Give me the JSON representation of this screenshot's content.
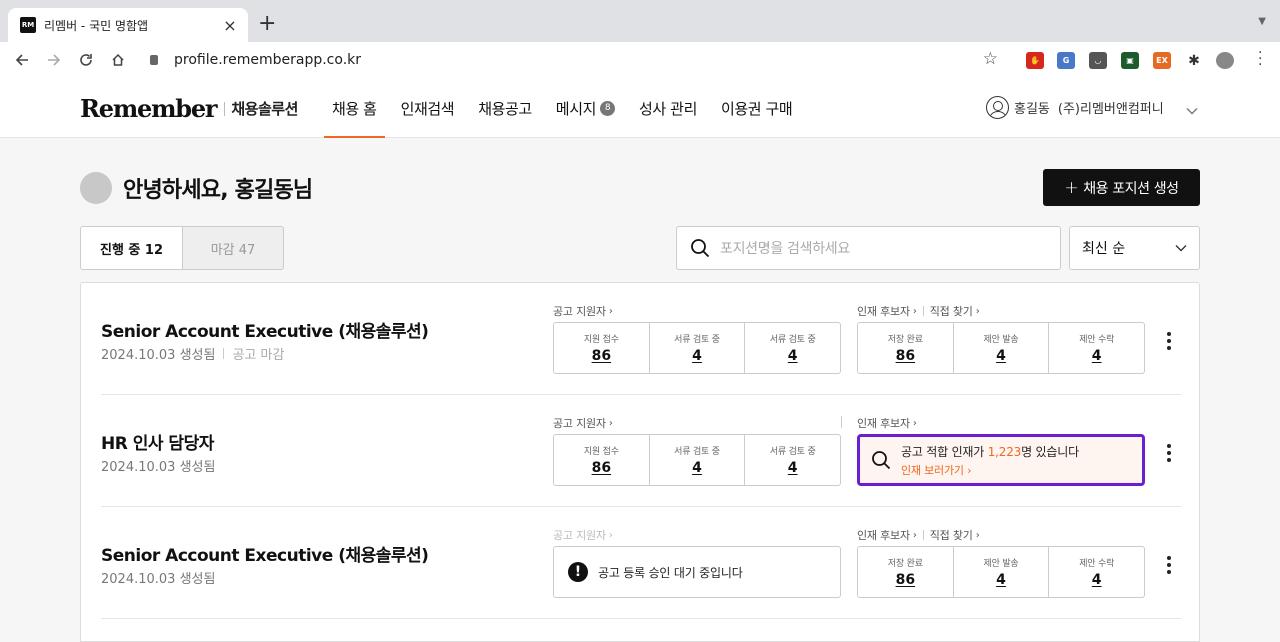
{
  "browser": {
    "tab_title": "리멤버 - 국민 명함앱",
    "favicon_text": "RM",
    "url": "profile.rememberapp.co.kr"
  },
  "header": {
    "logo": "Remember",
    "logo_sub": "채용솔루션",
    "nav": [
      {
        "label": "채용 홈",
        "active": true
      },
      {
        "label": "인재검색"
      },
      {
        "label": "채용공고"
      },
      {
        "label": "메시지",
        "badge": "8"
      },
      {
        "label": "성사 관리"
      },
      {
        "label": "이용권 구매"
      }
    ],
    "user_name": "홍길동",
    "company": "(주)리멤버앤컴퍼니"
  },
  "main": {
    "greeting": "안녕하세요, 홍길동님",
    "create_button": "채용 포지션 생성",
    "tabs": [
      "진행 중 12",
      "마감 47"
    ],
    "search_placeholder": "포지션명을 검색하세요",
    "sort": "최신 순"
  },
  "labels": {
    "applicants": "공고 지원자",
    "candidates": "인재 후보자",
    "direct": "직접 찾기",
    "stat_received": "지원 접수",
    "stat_reviewing": "서류 검토 중",
    "stat_saved": "저장 완료",
    "stat_sent": "제안 발송",
    "stat_accepted": "제안 수락"
  },
  "jobs": [
    {
      "title": "Senior Account Executive (채용솔루션)",
      "date": "2024.10.03 생성됨",
      "status": "공고 마감",
      "applicants": [
        "86",
        "4",
        "4"
      ],
      "candidates": [
        "86",
        "4",
        "4"
      ]
    },
    {
      "title": "HR 인사 담당자",
      "date": "2024.10.03 생성됨",
      "applicants": [
        "86",
        "4",
        "4"
      ],
      "promo_prefix": "공고 적합 인재가 ",
      "promo_count": "1,223",
      "promo_suffix": "명 있습니다",
      "promo_link": "인재 보러가기"
    },
    {
      "title": "Senior Account Executive (채용솔루션)",
      "date": "2024.10.03 생성됨",
      "notice": "공고 등록 승인 대기 중입니다",
      "candidates": [
        "86",
        "4",
        "4"
      ]
    }
  ]
}
